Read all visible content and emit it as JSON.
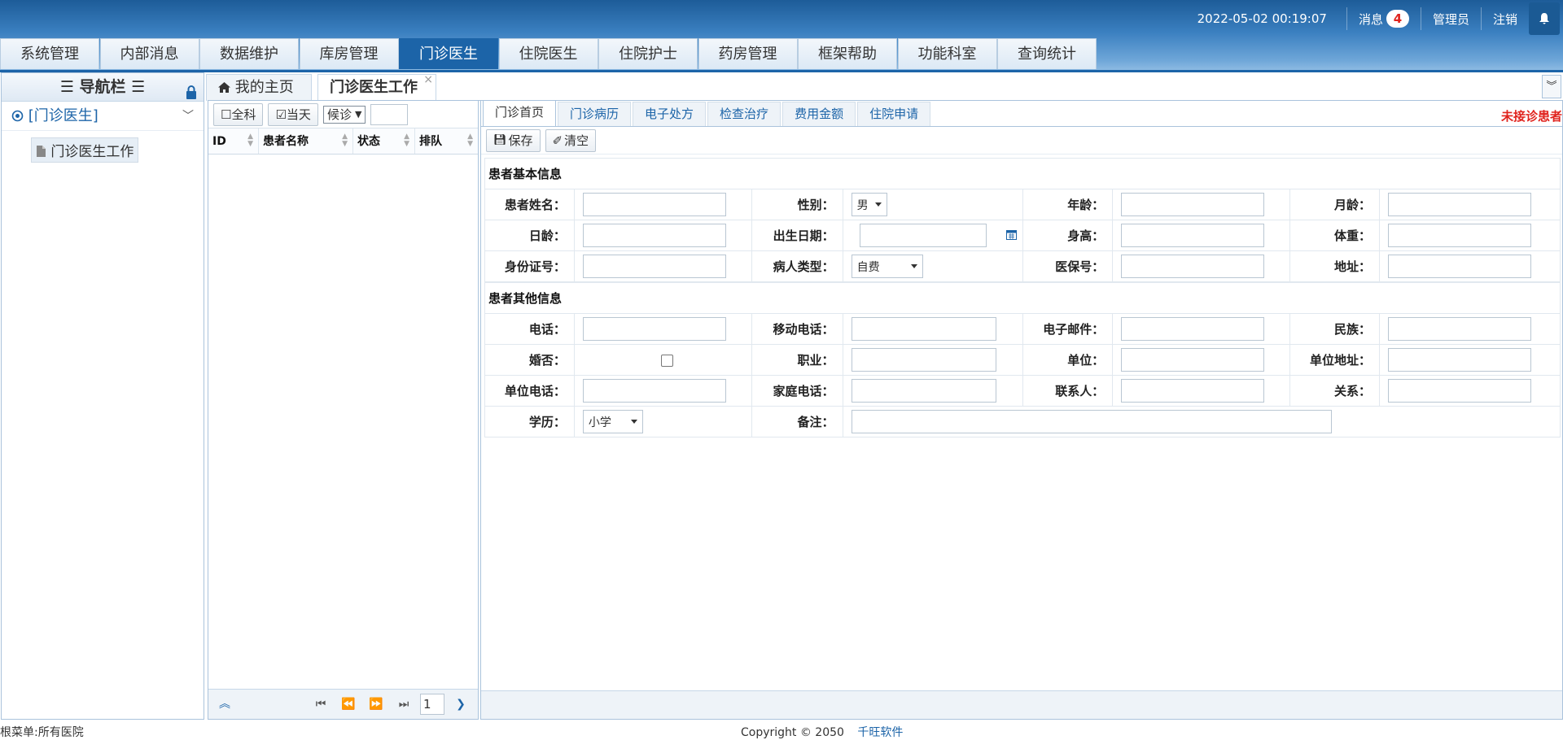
{
  "header": {
    "datetime": "2022-05-02 00:19:07",
    "messages_label": "消息",
    "messages_count": "4",
    "user": "管理员",
    "logout": "注销"
  },
  "main_menu": [
    "系统管理",
    "内部消息",
    "数据维护",
    "库房管理",
    "门诊医生",
    "住院医生",
    "住院护士",
    "药房管理",
    "框架帮助",
    "功能科室",
    "查询统计"
  ],
  "main_menu_active": "门诊医生",
  "nav": {
    "title": "导航栏",
    "group": "[门诊医生]",
    "leaf": "门诊医生工作"
  },
  "tabs": {
    "home": "我的主页",
    "work": "门诊医生工作",
    "close": "×"
  },
  "patient_list": {
    "all_dept": "全科",
    "today": "当天",
    "status_select": "候诊",
    "columns": [
      "ID",
      "患者名称",
      "状态",
      "排队"
    ],
    "page": "1"
  },
  "workspace": {
    "subtabs": [
      "门诊首页",
      "门诊病历",
      "电子处方",
      "检查治疗",
      "费用金额",
      "住院申请"
    ],
    "warning": "未接诊患者",
    "save": "保存",
    "clear": "清空"
  },
  "form": {
    "basic_title": "患者基本信息",
    "other_title": "患者其他信息",
    "labels": {
      "name": "患者姓名：",
      "gender": "性别：",
      "age": "年龄：",
      "age_month": "月龄：",
      "age_day": "日龄：",
      "birth": "出生日期：",
      "height": "身高：",
      "weight": "体重：",
      "id_card": "身份证号：",
      "patient_type": "病人类型：",
      "insurance": "医保号：",
      "address": "地址：",
      "phone": "电话：",
      "mobile": "移动电话：",
      "email": "电子邮件：",
      "ethnicity": "民族：",
      "married": "婚否：",
      "occupation": "职业：",
      "employer": "单位：",
      "employer_address": "单位地址：",
      "employer_phone": "单位电话：",
      "home_phone": "家庭电话：",
      "contact": "联系人：",
      "relation": "关系：",
      "education": "学历：",
      "remark": "备注："
    },
    "values": {
      "gender": "男",
      "patient_type": "自费",
      "education": "小学"
    }
  },
  "footer": {
    "root": "根菜单:所有医院",
    "copyright": "Copyright © 2050",
    "company": "千旺软件"
  }
}
